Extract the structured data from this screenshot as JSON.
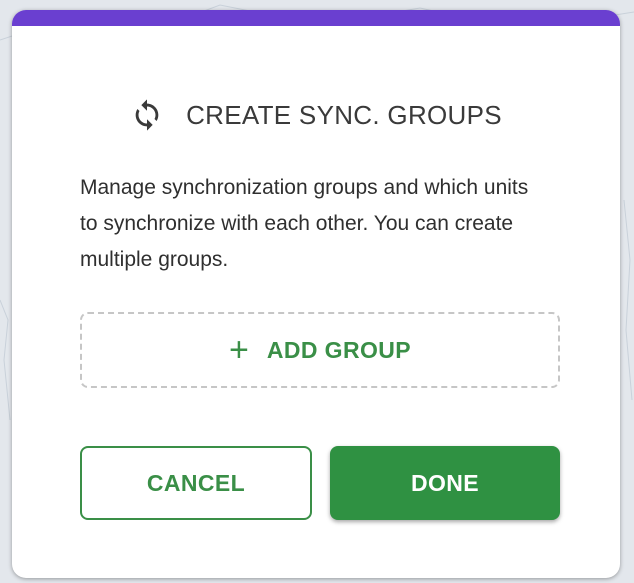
{
  "dialog": {
    "title": "CREATE SYNC. GROUPS",
    "title_icon": "sync-icon",
    "description": "Manage synchronization groups and which units to synchronize with each other. You can create multiple groups.",
    "add_group": {
      "icon": "plus-icon",
      "icon_glyph": "+",
      "label": "ADD GROUP"
    },
    "buttons": {
      "cancel": "CANCEL",
      "done": "DONE"
    }
  },
  "colors": {
    "accent_bar": "#6a3fd0",
    "primary_green": "#2f9142",
    "text_green": "#3a8f47"
  }
}
